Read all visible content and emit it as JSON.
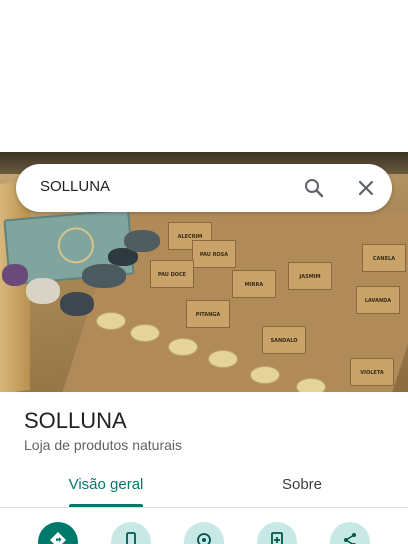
{
  "search": {
    "query": "SOLLUNA"
  },
  "place": {
    "name": "SOLLUNA",
    "category": "Loja de produtos naturais"
  },
  "tabs": [
    {
      "label": "Visão geral",
      "selected": true
    },
    {
      "label": "Sobre",
      "selected": false
    }
  ],
  "photo": {
    "card_labels": [
      "ALECRIM",
      "PAU ROSA",
      "PAU DOCE",
      "JASMIM",
      "LAVANDA",
      "SANDALO",
      "PITANGA",
      "VIOLETA",
      "CANELA",
      "MIRRA"
    ]
  },
  "actions": [
    {
      "icon": "directions-icon"
    },
    {
      "icon": "phone-icon"
    },
    {
      "icon": "save-location-icon"
    },
    {
      "icon": "add-to-list-icon"
    },
    {
      "icon": "share-icon"
    }
  ],
  "colors": {
    "accent": "#00796b",
    "action_bg": "#c7e8e4"
  }
}
